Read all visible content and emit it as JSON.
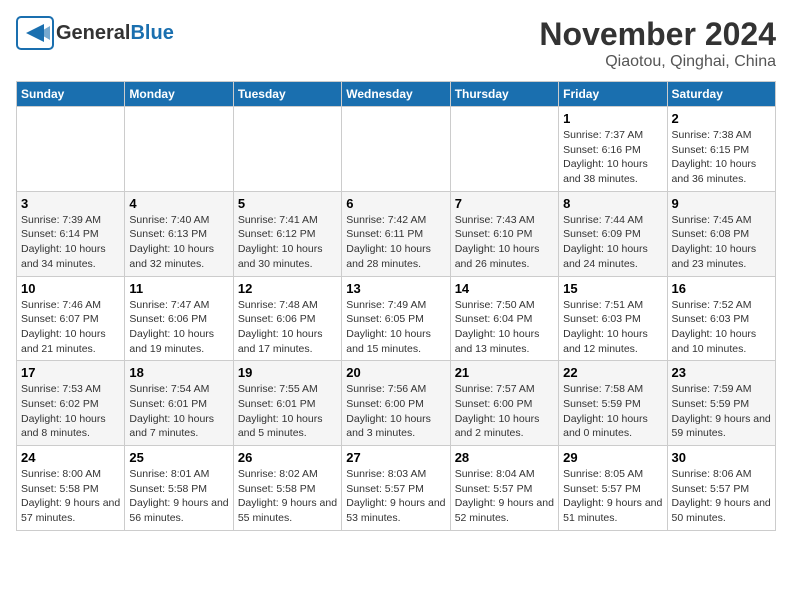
{
  "header": {
    "logo_general": "General",
    "logo_blue": "Blue",
    "title": "November 2024",
    "subtitle": "Qiaotou, Qinghai, China"
  },
  "weekdays": [
    "Sunday",
    "Monday",
    "Tuesday",
    "Wednesday",
    "Thursday",
    "Friday",
    "Saturday"
  ],
  "weeks": [
    [
      {
        "day": "",
        "info": ""
      },
      {
        "day": "",
        "info": ""
      },
      {
        "day": "",
        "info": ""
      },
      {
        "day": "",
        "info": ""
      },
      {
        "day": "",
        "info": ""
      },
      {
        "day": "1",
        "info": "Sunrise: 7:37 AM\nSunset: 6:16 PM\nDaylight: 10 hours and 38 minutes."
      },
      {
        "day": "2",
        "info": "Sunrise: 7:38 AM\nSunset: 6:15 PM\nDaylight: 10 hours and 36 minutes."
      }
    ],
    [
      {
        "day": "3",
        "info": "Sunrise: 7:39 AM\nSunset: 6:14 PM\nDaylight: 10 hours and 34 minutes."
      },
      {
        "day": "4",
        "info": "Sunrise: 7:40 AM\nSunset: 6:13 PM\nDaylight: 10 hours and 32 minutes."
      },
      {
        "day": "5",
        "info": "Sunrise: 7:41 AM\nSunset: 6:12 PM\nDaylight: 10 hours and 30 minutes."
      },
      {
        "day": "6",
        "info": "Sunrise: 7:42 AM\nSunset: 6:11 PM\nDaylight: 10 hours and 28 minutes."
      },
      {
        "day": "7",
        "info": "Sunrise: 7:43 AM\nSunset: 6:10 PM\nDaylight: 10 hours and 26 minutes."
      },
      {
        "day": "8",
        "info": "Sunrise: 7:44 AM\nSunset: 6:09 PM\nDaylight: 10 hours and 24 minutes."
      },
      {
        "day": "9",
        "info": "Sunrise: 7:45 AM\nSunset: 6:08 PM\nDaylight: 10 hours and 23 minutes."
      }
    ],
    [
      {
        "day": "10",
        "info": "Sunrise: 7:46 AM\nSunset: 6:07 PM\nDaylight: 10 hours and 21 minutes."
      },
      {
        "day": "11",
        "info": "Sunrise: 7:47 AM\nSunset: 6:06 PM\nDaylight: 10 hours and 19 minutes."
      },
      {
        "day": "12",
        "info": "Sunrise: 7:48 AM\nSunset: 6:06 PM\nDaylight: 10 hours and 17 minutes."
      },
      {
        "day": "13",
        "info": "Sunrise: 7:49 AM\nSunset: 6:05 PM\nDaylight: 10 hours and 15 minutes."
      },
      {
        "day": "14",
        "info": "Sunrise: 7:50 AM\nSunset: 6:04 PM\nDaylight: 10 hours and 13 minutes."
      },
      {
        "day": "15",
        "info": "Sunrise: 7:51 AM\nSunset: 6:03 PM\nDaylight: 10 hours and 12 minutes."
      },
      {
        "day": "16",
        "info": "Sunrise: 7:52 AM\nSunset: 6:03 PM\nDaylight: 10 hours and 10 minutes."
      }
    ],
    [
      {
        "day": "17",
        "info": "Sunrise: 7:53 AM\nSunset: 6:02 PM\nDaylight: 10 hours and 8 minutes."
      },
      {
        "day": "18",
        "info": "Sunrise: 7:54 AM\nSunset: 6:01 PM\nDaylight: 10 hours and 7 minutes."
      },
      {
        "day": "19",
        "info": "Sunrise: 7:55 AM\nSunset: 6:01 PM\nDaylight: 10 hours and 5 minutes."
      },
      {
        "day": "20",
        "info": "Sunrise: 7:56 AM\nSunset: 6:00 PM\nDaylight: 10 hours and 3 minutes."
      },
      {
        "day": "21",
        "info": "Sunrise: 7:57 AM\nSunset: 6:00 PM\nDaylight: 10 hours and 2 minutes."
      },
      {
        "day": "22",
        "info": "Sunrise: 7:58 AM\nSunset: 5:59 PM\nDaylight: 10 hours and 0 minutes."
      },
      {
        "day": "23",
        "info": "Sunrise: 7:59 AM\nSunset: 5:59 PM\nDaylight: 9 hours and 59 minutes."
      }
    ],
    [
      {
        "day": "24",
        "info": "Sunrise: 8:00 AM\nSunset: 5:58 PM\nDaylight: 9 hours and 57 minutes."
      },
      {
        "day": "25",
        "info": "Sunrise: 8:01 AM\nSunset: 5:58 PM\nDaylight: 9 hours and 56 minutes."
      },
      {
        "day": "26",
        "info": "Sunrise: 8:02 AM\nSunset: 5:58 PM\nDaylight: 9 hours and 55 minutes."
      },
      {
        "day": "27",
        "info": "Sunrise: 8:03 AM\nSunset: 5:57 PM\nDaylight: 9 hours and 53 minutes."
      },
      {
        "day": "28",
        "info": "Sunrise: 8:04 AM\nSunset: 5:57 PM\nDaylight: 9 hours and 52 minutes."
      },
      {
        "day": "29",
        "info": "Sunrise: 8:05 AM\nSunset: 5:57 PM\nDaylight: 9 hours and 51 minutes."
      },
      {
        "day": "30",
        "info": "Sunrise: 8:06 AM\nSunset: 5:57 PM\nDaylight: 9 hours and 50 minutes."
      }
    ]
  ]
}
